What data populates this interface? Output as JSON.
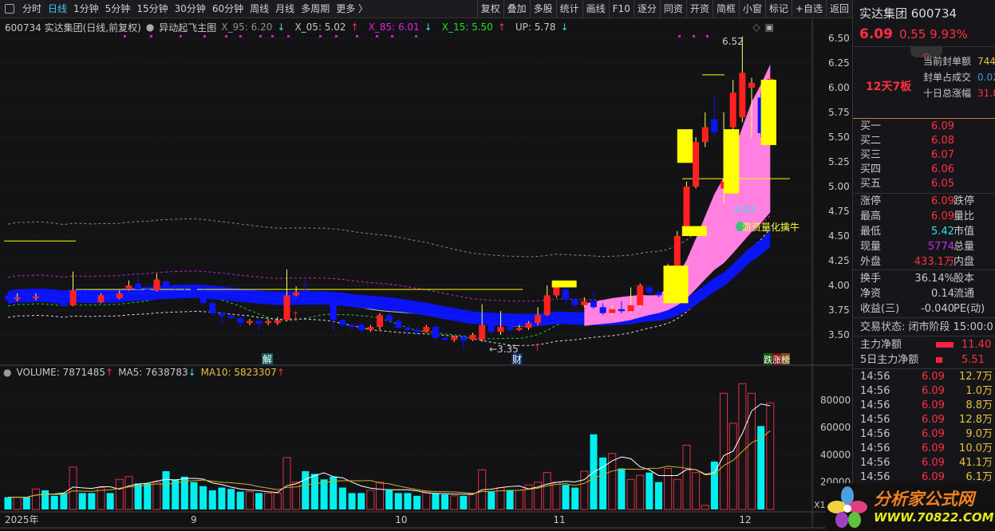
{
  "toolbar": {
    "periods": [
      "分时",
      "日线",
      "1分钟",
      "5分钟",
      "15分钟",
      "30分钟",
      "60分钟",
      "周线",
      "月线",
      "多周期",
      "更多 〉"
    ],
    "active_period": "日线",
    "buttons": [
      "复权",
      "叠加",
      "多股",
      "统计",
      "画线",
      "F10",
      "逐分",
      "同资",
      "开资",
      "简框",
      "小窗",
      "标记",
      "+自选",
      "返回"
    ]
  },
  "legend": {
    "title": "600734 实达集团(日线,前复权)",
    "indicator": "异动起飞主图",
    "x95": "X_95: 6.20",
    "x05": "X_05: 5.02",
    "x85": "X_85: 6.01",
    "x15": "X_15: 5.50",
    "up": "UP: 5.78"
  },
  "colors": {
    "up": "#ff2020",
    "down": "#0a14ff",
    "vol_down": "#00f0f0",
    "yellow": "#ffff00",
    "pink": "#ff80e0",
    "bg": "#131316"
  },
  "chart_data": {
    "type": "candlestick",
    "price_ticks": [
      "6.50",
      "6.25",
      "6.00",
      "5.75",
      "5.50",
      "5.25",
      "5.00",
      "4.75",
      "4.50",
      "4.25",
      "4.00",
      "3.75",
      "3.50"
    ],
    "ylim": [
      3.5,
      6.5
    ],
    "month_labels": [
      {
        "i": 0,
        "label": "2025年"
      },
      {
        "i": 20,
        "label": "9"
      },
      {
        "i": 42,
        "label": "10"
      },
      {
        "i": 59,
        "label": "11"
      },
      {
        "i": 79,
        "label": "12"
      }
    ],
    "candles": [
      [
        3.9,
        3.85,
        3.93,
        3.83,
        9000
      ],
      [
        3.86,
        3.88,
        3.92,
        3.84,
        9000
      ],
      [
        3.88,
        3.87,
        3.91,
        3.85,
        9000
      ],
      [
        3.87,
        3.89,
        3.92,
        3.85,
        15000
      ],
      [
        3.89,
        3.86,
        3.91,
        3.84,
        14000
      ],
      [
        3.86,
        3.82,
        3.87,
        3.81,
        10000
      ],
      [
        3.82,
        3.79,
        3.84,
        3.78,
        12000
      ],
      [
        3.8,
        3.95,
        4.14,
        3.79,
        31000
      ],
      [
        3.95,
        3.85,
        3.96,
        3.83,
        12000
      ],
      [
        3.85,
        3.83,
        3.87,
        3.82,
        12000
      ],
      [
        3.83,
        3.9,
        3.92,
        3.82,
        16000
      ],
      [
        3.9,
        3.87,
        3.91,
        3.85,
        12000
      ],
      [
        3.87,
        3.92,
        3.95,
        3.86,
        22000
      ],
      [
        3.96,
        4.0,
        4.05,
        3.95,
        24000
      ],
      [
        4.02,
        3.96,
        4.1,
        3.95,
        19000
      ],
      [
        3.96,
        3.95,
        3.98,
        3.93,
        19000
      ],
      [
        3.95,
        4.06,
        4.12,
        3.94,
        20000
      ],
      [
        4.04,
        3.99,
        4.06,
        3.97,
        28000
      ],
      [
        3.99,
        3.98,
        4.01,
        3.96,
        22000
      ],
      [
        3.98,
        3.97,
        4.0,
        3.95,
        24000
      ],
      [
        3.97,
        3.95,
        3.98,
        3.93,
        20000
      ],
      [
        3.95,
        3.82,
        3.96,
        3.8,
        17000
      ],
      [
        3.82,
        3.72,
        3.84,
        3.7,
        14000
      ],
      [
        3.72,
        3.69,
        3.74,
        3.62,
        16000
      ],
      [
        3.69,
        3.67,
        3.72,
        3.66,
        15000
      ],
      [
        3.67,
        3.62,
        3.68,
        3.58,
        13000
      ],
      [
        3.62,
        3.64,
        3.66,
        3.6,
        13000
      ],
      [
        3.64,
        3.61,
        3.66,
        3.55,
        12000
      ],
      [
        3.62,
        3.64,
        3.66,
        3.6,
        12000
      ],
      [
        3.62,
        3.65,
        3.68,
        3.6,
        12000
      ],
      [
        3.65,
        3.9,
        4.16,
        3.64,
        38000
      ],
      [
        3.9,
        3.93,
        3.99,
        3.89,
        20000
      ],
      [
        3.95,
        3.9,
        4.05,
        3.88,
        28000
      ],
      [
        3.9,
        3.88,
        3.92,
        3.86,
        26000
      ],
      [
        3.88,
        3.85,
        3.9,
        3.84,
        22000
      ],
      [
        3.85,
        3.65,
        3.86,
        3.55,
        24000
      ],
      [
        3.65,
        3.6,
        3.66,
        3.58,
        16000
      ],
      [
        3.6,
        3.58,
        3.62,
        3.55,
        12000
      ],
      [
        3.6,
        3.55,
        3.62,
        3.52,
        12000
      ],
      [
        3.55,
        3.58,
        3.6,
        3.53,
        14000
      ],
      [
        3.58,
        3.7,
        3.72,
        3.55,
        20000
      ],
      [
        3.7,
        3.64,
        3.72,
        3.63,
        14000
      ],
      [
        3.64,
        3.57,
        3.66,
        3.56,
        12000
      ],
      [
        3.57,
        3.55,
        3.58,
        3.5,
        12000
      ],
      [
        3.55,
        3.53,
        3.57,
        3.5,
        10000
      ],
      [
        3.53,
        3.58,
        3.6,
        3.52,
        13000
      ],
      [
        3.58,
        3.47,
        3.6,
        3.45,
        12000
      ],
      [
        3.47,
        3.45,
        3.49,
        3.44,
        11000
      ],
      [
        3.45,
        3.48,
        3.49,
        3.43,
        10000
      ],
      [
        3.48,
        3.44,
        3.5,
        3.35,
        10000
      ],
      [
        3.45,
        3.5,
        3.52,
        3.44,
        12000
      ],
      [
        3.45,
        3.6,
        3.81,
        3.43,
        29000
      ],
      [
        3.6,
        3.53,
        3.62,
        3.5,
        13000
      ],
      [
        3.53,
        3.58,
        3.74,
        3.5,
        16000
      ],
      [
        3.58,
        3.55,
        3.62,
        3.52,
        14000
      ],
      [
        3.55,
        3.57,
        3.6,
        3.54,
        14000
      ],
      [
        3.57,
        3.62,
        3.64,
        3.55,
        18000
      ],
      [
        3.62,
        3.7,
        3.78,
        3.6,
        20000
      ],
      [
        3.7,
        3.9,
        4.0,
        3.69,
        27000
      ],
      [
        3.9,
        3.98,
        4.02,
        3.88,
        20000
      ],
      [
        3.96,
        3.86,
        4.0,
        3.8,
        18000
      ],
      [
        3.86,
        3.8,
        3.88,
        3.78,
        16000
      ],
      [
        3.8,
        3.84,
        3.88,
        3.78,
        28000
      ],
      [
        3.84,
        3.78,
        3.95,
        3.76,
        55000
      ],
      [
        3.78,
        3.72,
        3.82,
        3.7,
        38000
      ],
      [
        3.72,
        3.76,
        3.8,
        3.7,
        41000
      ],
      [
        3.76,
        3.74,
        3.84,
        3.72,
        30000
      ],
      [
        3.74,
        3.8,
        3.98,
        3.72,
        22000
      ],
      [
        3.8,
        4.0,
        4.02,
        3.78,
        25000
      ],
      [
        3.98,
        3.93,
        4.0,
        3.9,
        27000
      ],
      [
        3.93,
        3.9,
        3.95,
        3.88,
        20000
      ],
      [
        3.9,
        4.2,
        4.22,
        3.88,
        30000
      ],
      [
        4.2,
        4.5,
        4.55,
        4.15,
        22000
      ],
      [
        4.55,
        5.0,
        5.05,
        4.5,
        47000
      ],
      [
        5.0,
        5.45,
        5.5,
        4.98,
        27000
      ],
      [
        5.45,
        5.6,
        5.75,
        5.4,
        3000
      ],
      [
        5.68,
        5.55,
        5.92,
        5.52,
        35000
      ],
      [
        4.98,
        5.05,
        5.75,
        4.83,
        85000
      ],
      [
        5.6,
        5.95,
        6.08,
        5.55,
        63000
      ],
      [
        5.7,
        6.15,
        6.52,
        5.65,
        92000
      ],
      [
        6.0,
        6.05,
        6.1,
        5.5,
        85000
      ],
      [
        5.9,
        5.54,
        5.95,
        5.5,
        61000
      ],
      [
        5.54,
        6.09,
        6.09,
        5.42,
        78000
      ]
    ],
    "yellow_boxes": [
      [
        0,
        95,
        4.45,
        4.45
      ],
      [
        58,
        61,
        3.98,
        4.05
      ],
      [
        72,
        75,
        4.5,
        4.6
      ],
      [
        72,
        74,
        5.24,
        5.58
      ],
      [
        77,
        79,
        4.93,
        5.58
      ],
      [
        81,
        83,
        5.42,
        6.08
      ],
      [
        70,
        73,
        3.82,
        4.2
      ]
    ],
    "annotations": {
      "high": "6.52",
      "low_mark": "←3.35",
      "value": "4.83",
      "signal": "游资量化擒牛",
      "tag_jie": "解",
      "tag_cai": "财",
      "tag_rank": [
        "跌",
        "涨",
        "榜"
      ]
    },
    "volume": {
      "legend": {
        "vol": "VOLUME: 7871485",
        "ma5": "MA5: 7638783",
        "ma10": "MA10: 5823307"
      },
      "ticks": [
        "80000",
        "60000",
        "40000",
        "20000"
      ],
      "unit": "X10",
      "ylim": [
        0,
        95000
      ]
    }
  },
  "quote": {
    "title": "实达集团 600734",
    "price": "6.09",
    "change": "0.55",
    "pct": "9.93%",
    "streak": "12天7板",
    "seal": [
      {
        "k": "当前封单额",
        "v": "744"
      },
      {
        "k": "封单占成交",
        "v": "0.02"
      },
      {
        "k": "十日总涨幅",
        "v": "31.8"
      }
    ],
    "bids": [
      {
        "k": "买一",
        "v": "6.09"
      },
      {
        "k": "买二",
        "v": "6.08"
      },
      {
        "k": "买三",
        "v": "6.07"
      },
      {
        "k": "买四",
        "v": "6.06"
      },
      {
        "k": "买五",
        "v": "6.05"
      }
    ],
    "stats": [
      {
        "k": "涨停",
        "v": "6.09",
        "k2": "跌停"
      },
      {
        "k": "最高",
        "v": "6.09",
        "k2": "量比"
      },
      {
        "k": "最低",
        "v": "5.42",
        "k2": "市值"
      },
      {
        "k": "现量",
        "v": "5774",
        "k2": "总量"
      },
      {
        "k": "外盘",
        "v": "433.1万",
        "k2": "内盘"
      }
    ],
    "stats2": [
      {
        "k": "换手",
        "v": "36.14%",
        "k2": "股本"
      },
      {
        "k": "净资",
        "v": "0.14",
        "k2": "流通"
      },
      {
        "k": "收益(三)",
        "v": "-0.040",
        "k2": "PE(动)"
      }
    ],
    "status": "交易状态: 闭市阶段 15:00:0",
    "flows": [
      {
        "k": "主力净额",
        "v": "11.40"
      },
      {
        "k": "5日主力净额",
        "v": "5.51"
      }
    ],
    "ticks": [
      {
        "t": "14:56",
        "p": "6.09",
        "v": "12.7万"
      },
      {
        "t": "14:56",
        "p": "6.09",
        "v": "1.0万"
      },
      {
        "t": "14:56",
        "p": "6.09",
        "v": "8.8万"
      },
      {
        "t": "14:56",
        "p": "6.09",
        "v": "12.8万"
      },
      {
        "t": "14:56",
        "p": "6.09",
        "v": "9.0万"
      },
      {
        "t": "14:56",
        "p": "6.09",
        "v": "10.0万"
      },
      {
        "t": "14:56",
        "p": "6.09",
        "v": "41.1万"
      },
      {
        "t": "14:56",
        "p": "6.09",
        "v": "6.1万"
      }
    ]
  },
  "logo": {
    "name": "分析家公式网",
    "url": "WWW.70822.COM"
  }
}
